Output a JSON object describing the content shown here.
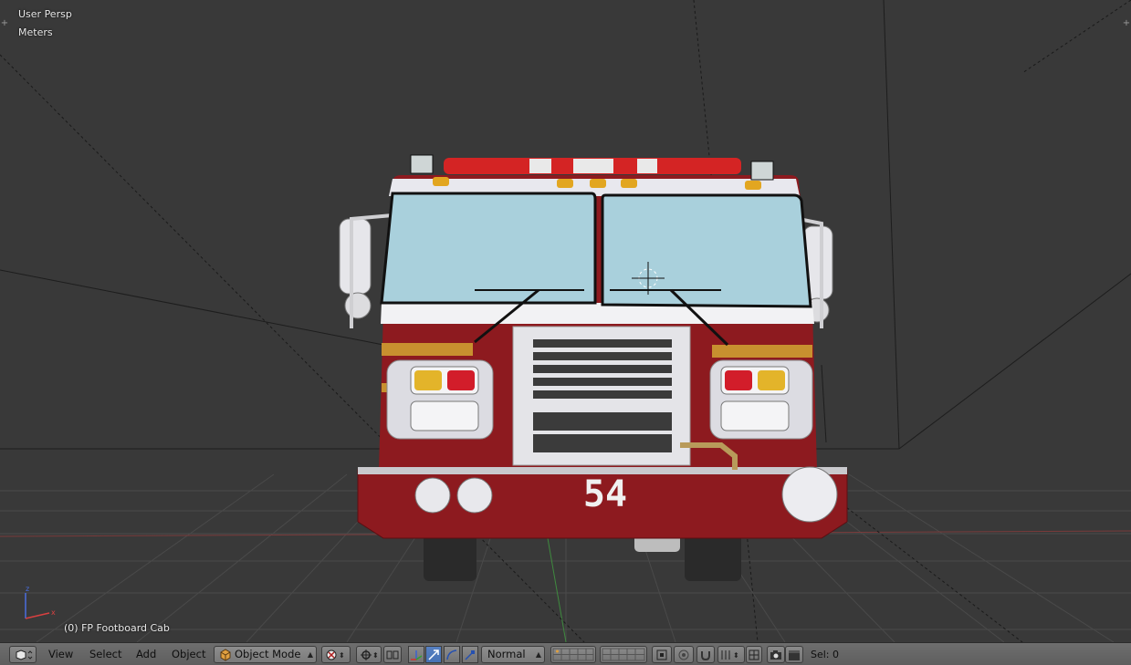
{
  "viewport": {
    "view_label": "User Persp",
    "units_label": "Meters",
    "object_label": "(0) FP Footboard Cab",
    "truck_number": "54"
  },
  "header": {
    "menus": [
      "View",
      "Select",
      "Add",
      "Object"
    ],
    "mode_label": "Object Mode",
    "orientation_label": "Normal",
    "selection_info": "Sel: 0"
  },
  "colors": {
    "viewport_bg": "#393939",
    "header_bg": "#6e6e6e",
    "truck_red": "#8d1a1f",
    "active_button": "#5680c2"
  },
  "icons": {
    "editor_type": "3d-view-icon",
    "mode": "cube-icon",
    "shading": "shading-icon",
    "pivot": "pivot-icon",
    "manipulator": "manipulator-icon"
  }
}
